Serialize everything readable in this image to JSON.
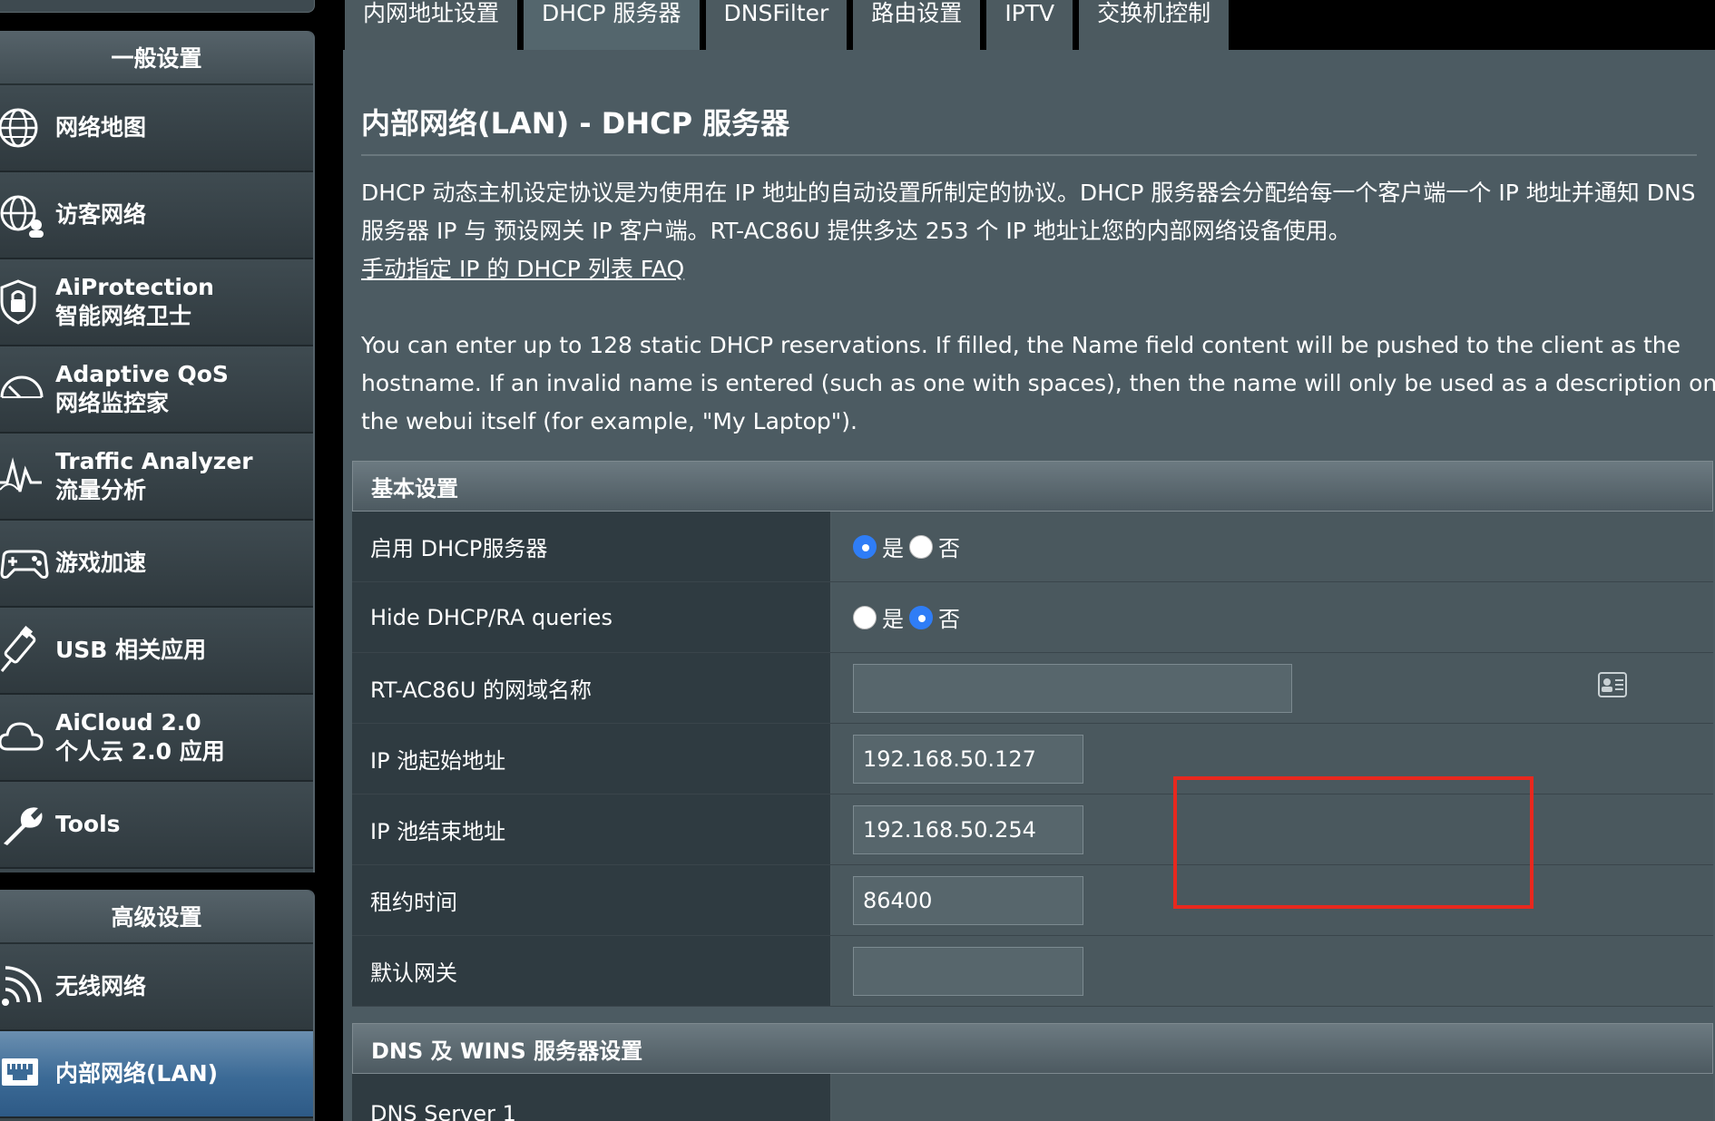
{
  "sidebar": {
    "general_header": "一般设置",
    "advanced_header": "高级设置",
    "general_items": [
      {
        "line1": "网络地图",
        "line2": "",
        "icon": "globe-icon"
      },
      {
        "line1": "访客网络",
        "line2": "",
        "icon": "guest-globe-icon"
      },
      {
        "line1": "AiProtection",
        "line2": "智能网络卫士",
        "icon": "shield-lock-icon"
      },
      {
        "line1": "Adaptive QoS",
        "line2": "网络监控家",
        "icon": "speedometer-icon"
      },
      {
        "line1": "Traffic Analyzer",
        "line2": "流量分析",
        "icon": "traffic-wave-icon"
      },
      {
        "line1": "游戏加速",
        "line2": "",
        "icon": "gamepad-icon"
      },
      {
        "line1": "USB 相关应用",
        "line2": "",
        "icon": "usb-icon"
      },
      {
        "line1": "AiCloud 2.0",
        "line2": "个人云 2.0 应用",
        "icon": "cloud-icon"
      },
      {
        "line1": "Tools",
        "line2": "",
        "icon": "wrench-icon"
      }
    ],
    "advanced_items": [
      {
        "line1": "无线网络",
        "line2": "",
        "icon": "wifi-icon"
      },
      {
        "line1": "内部网络(LAN)",
        "line2": "",
        "icon": "lan-port-icon"
      }
    ]
  },
  "tabs": [
    "内网地址设置",
    "DHCP 服务器",
    "DNSFilter",
    "路由设置",
    "IPTV",
    "交换机控制"
  ],
  "active_tab": "DHCP 服务器",
  "page": {
    "title": "内部网络(LAN) - DHCP 服务器",
    "description": "DHCP 动态主机设定协议是为使用在 IP 地址的自动设置所制定的协议。DHCP 服务器会分配给每一个客户端一个 IP 地址并通知 DNS 服务器 IP 与 预设网关 IP 客户端。RT-AC86U 提供多达 253 个 IP 地址让您的内部网络设备使用。",
    "faq_link": "手动指定 IP 的 DHCP 列表 FAQ",
    "note": "You can enter up to 128 static DHCP reservations. If filled, the Name field content will be pushed to the client as the hostname. If an invalid name is entered (such as one with spaces), then the name will only be used as a description on the webui itself (for example, \"My Laptop\")."
  },
  "basic": {
    "header": "基本设置",
    "enable_dhcp": {
      "label": "启用 DHCP服务器",
      "yes": "是",
      "no": "否",
      "selected": "yes"
    },
    "hide_dhcp": {
      "label": "Hide DHCP/RA queries",
      "yes": "是",
      "no": "否",
      "selected": "no"
    },
    "domain_name": {
      "label": "RT-AC86U 的网域名称",
      "value": ""
    },
    "ip_start": {
      "label": "IP 池起始地址",
      "value": "192.168.50.127"
    },
    "ip_end": {
      "label": "IP 池结束地址",
      "value": "192.168.50.254"
    },
    "lease_time": {
      "label": "租约时间",
      "value": "86400"
    },
    "gateway": {
      "label": "默认网关",
      "value": ""
    }
  },
  "dns": {
    "header": "DNS 及 WINS 服务器设置",
    "server1": {
      "label": "DNS Server 1",
      "value": ""
    }
  },
  "colors": {
    "highlight": "#e8281e",
    "radio_selected": "#2f7df6",
    "active_nav": "#3b6a96"
  }
}
